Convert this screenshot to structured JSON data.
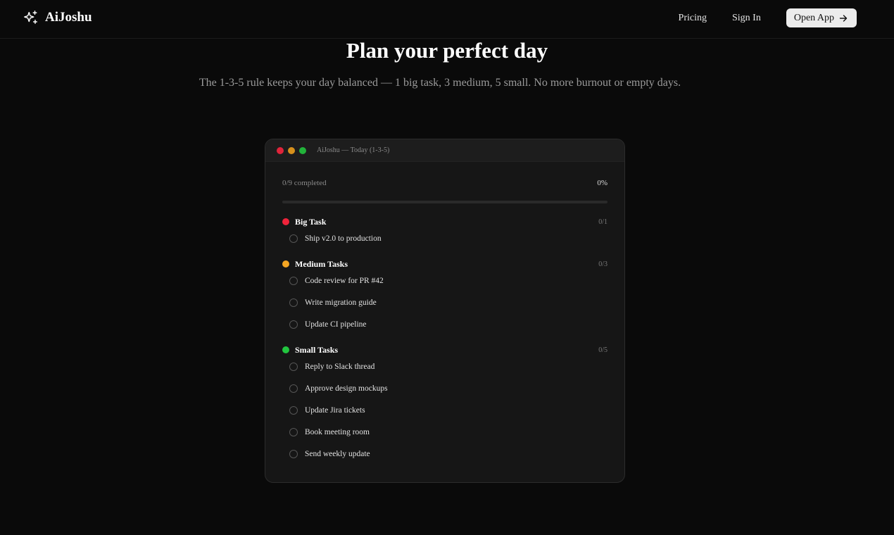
{
  "nav": {
    "brand": "AiJoshu",
    "links": [
      "Pricing",
      "Sign In"
    ],
    "cta": "Open App"
  },
  "hero": {
    "title": "Plan your perfect day",
    "subtitle": "The 1-3-5 rule keeps your day balanced — 1 big task, 3 medium, 5 small. No more burnout or empty days."
  },
  "window": {
    "title": "AiJoshu — Today (1-3-5)",
    "dots": [
      "#e0243a",
      "#d6901c",
      "#22b33a"
    ],
    "progress_label": "0/9 completed",
    "progress_percent": "0%",
    "progress_value": 0,
    "sections": [
      {
        "title": "Big Task",
        "count": "0/1",
        "color": "#f0233a",
        "tasks": [
          "Ship v2.0 to production"
        ]
      },
      {
        "title": "Medium Tasks",
        "count": "0/3",
        "color": "#f5a623",
        "tasks": [
          "Code review for PR #42",
          "Write migration guide",
          "Update CI pipeline"
        ]
      },
      {
        "title": "Small Tasks",
        "count": "0/5",
        "color": "#22c53f",
        "tasks": [
          "Reply to Slack thread",
          "Approve design mockups",
          "Update Jira tickets",
          "Book meeting room",
          "Send weekly update"
        ]
      }
    ]
  }
}
